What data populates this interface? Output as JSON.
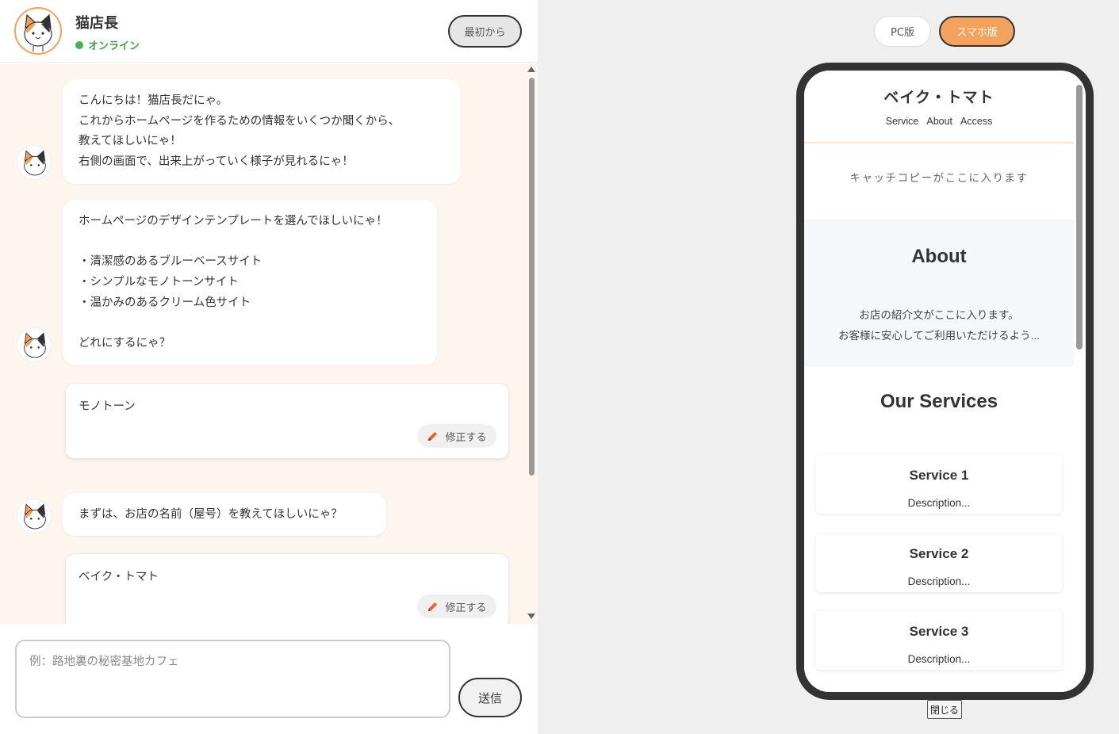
{
  "header": {
    "bot_name": "猫店長",
    "status": "オンライン",
    "restart_label": "最初から"
  },
  "messages": {
    "greeting": "こんにちは！猫店長だにゃ。\nこれからホームページを作るための情報をいくつか聞くから、\n教えてほしいにゃ！\n右側の画面で、出来上がっていく様子が見れるにゃ！",
    "template_question": "ホームページのデザインテンプレートを選んでほしいにゃ！\n\n・清潔感のあるブルーベースサイト\n・シンプルなモノトーンサイト\n・温かみのあるクリーム色サイト\n\nどれにするにゃ？",
    "user_answer_1": "モノトーン",
    "name_question": "まずは、お店の名前（屋号）を教えてほしいにゃ？",
    "user_answer_2": "ベイク・トマト",
    "edit_label": "修正する"
  },
  "input": {
    "placeholder": "例：路地裏の秘密基地カフェ",
    "send_label": "送信"
  },
  "preview": {
    "pc_label": "PC版",
    "sp_label": "スマホ版",
    "close_label": "閉じる",
    "site": {
      "title": "ベイク・トマト",
      "nav": [
        "Service",
        "About",
        "Access"
      ],
      "catch": "キャッチコピーがここに入ります",
      "about_title": "About",
      "about_line1": "お店の紹介文がここに入ります。",
      "about_line2": "お客様に安心してご利用いただけるよう...",
      "services_title": "Our Services",
      "services": [
        {
          "name": "Service 1",
          "desc": "Description..."
        },
        {
          "name": "Service 2",
          "desc": "Description..."
        },
        {
          "name": "Service 3",
          "desc": "Description..."
        }
      ]
    }
  },
  "colors": {
    "accent": "#f3a35d",
    "chat_bg": "#fdf6ee",
    "online": "#4caf50"
  }
}
